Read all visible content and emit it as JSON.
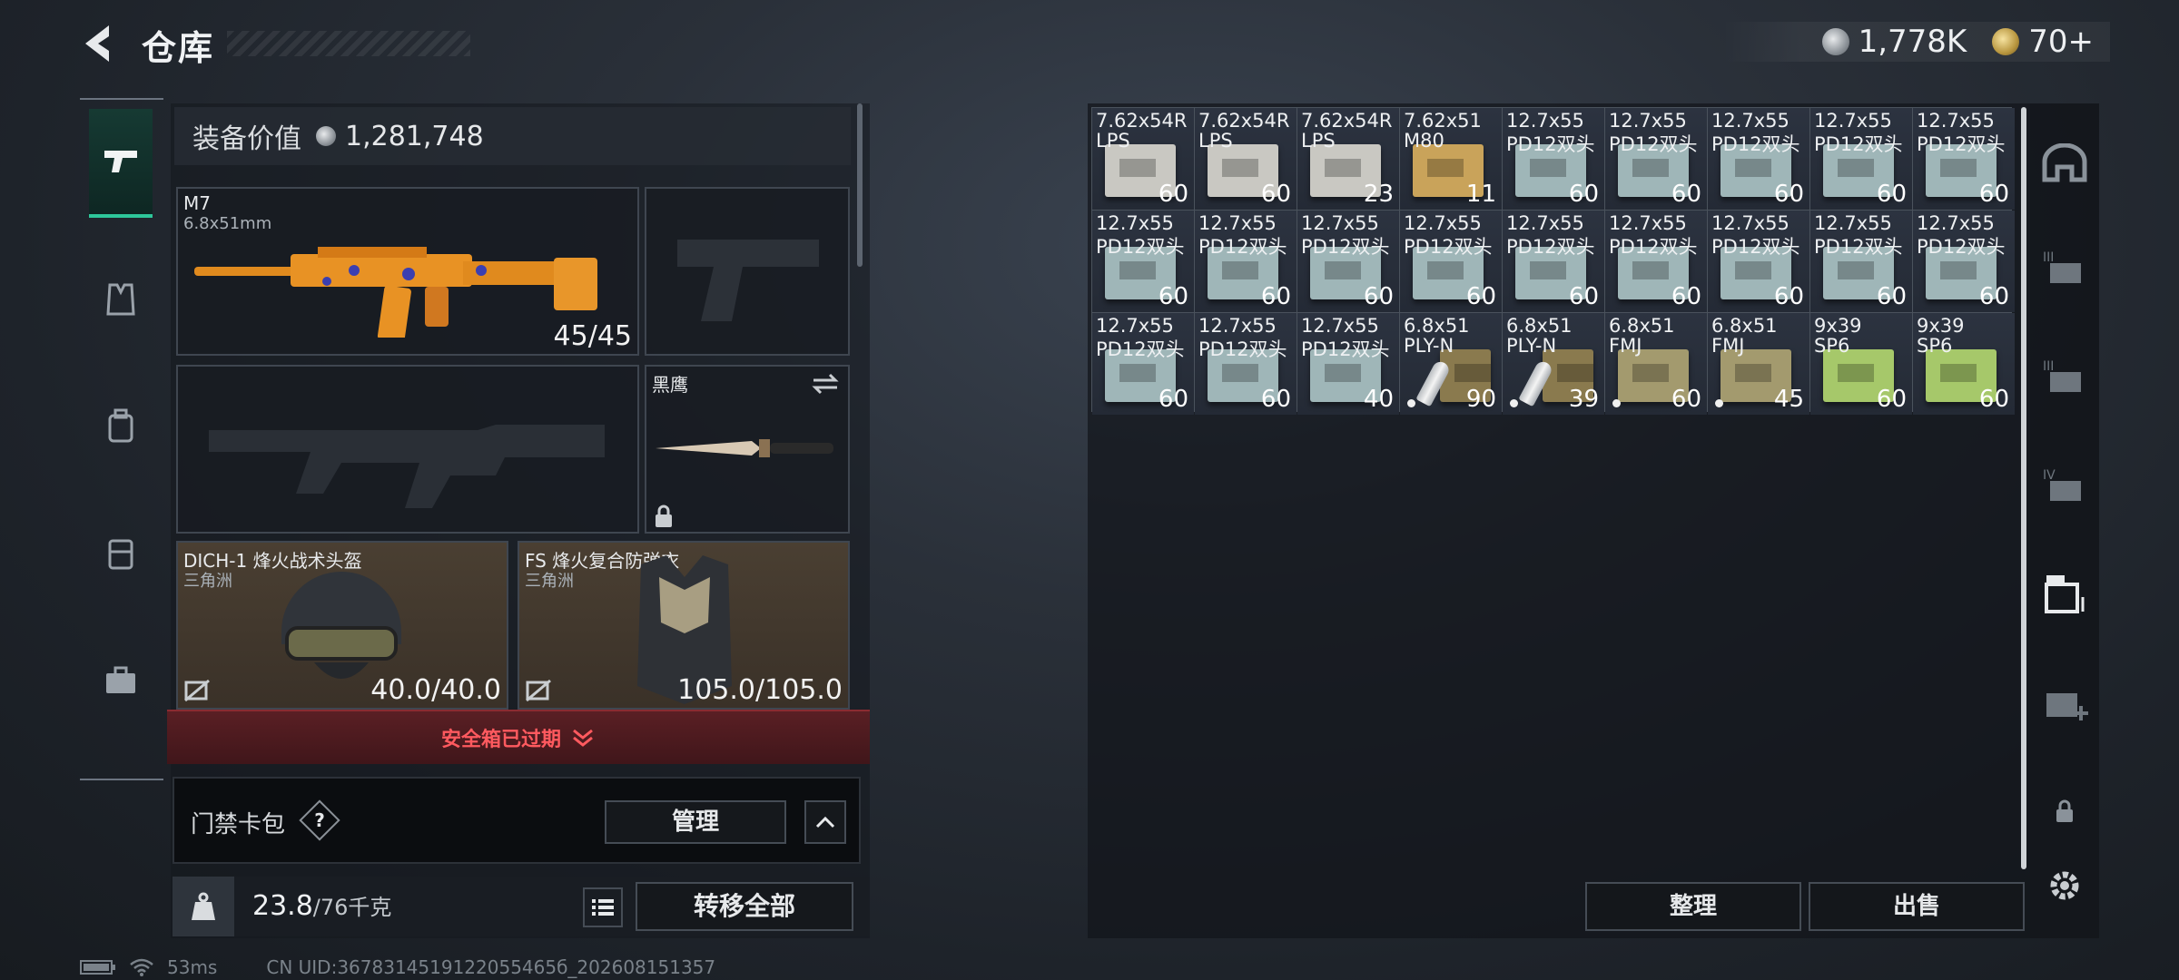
{
  "header": {
    "title": "仓库",
    "currencies": [
      {
        "icon": "silver-coin-icon",
        "value": "1,778K"
      },
      {
        "icon": "gold-coin-icon",
        "value": "70+"
      }
    ]
  },
  "left_tabs": [
    {
      "name": "firearms-tab",
      "icon": "pistol-icon",
      "active": true
    },
    {
      "name": "armor-tab",
      "icon": "vest-icon",
      "active": false
    },
    {
      "name": "backpack-tab",
      "icon": "backpack-icon",
      "active": false
    },
    {
      "name": "chest-rig-tab",
      "icon": "chest-rig-icon",
      "active": false
    },
    {
      "name": "toolbox-tab",
      "icon": "briefcase-icon",
      "active": false
    }
  ],
  "equipment": {
    "value_label": "装备价值",
    "value": "1,281,748",
    "primary_weapon": {
      "name": "M7",
      "caliber": "6.8x51mm",
      "ammo": "45/45"
    },
    "melee": {
      "name": "黑鹰"
    },
    "helmet": {
      "name": "DICH-1 烽火战术头盔",
      "brand": "三角洲",
      "durability": "40.0/40.0"
    },
    "armor": {
      "name": "FS 烽火复合防弹衣",
      "brand": "三角洲",
      "durability": "105.0/105.0"
    },
    "safebox_text": "安全箱已过期",
    "keycard_label": "门禁卡包",
    "help_label": "?",
    "manage_label": "管理",
    "weight_current": "23.8",
    "weight_max": "/76千克",
    "transfer_all_label": "转移全部"
  },
  "status": {
    "ping": "53ms",
    "uid": "CN UID:3678314519122055465б_202608151357"
  },
  "storage": {
    "items": [
      {
        "n1": "7.62x54R",
        "n2": "LPS",
        "count": "60",
        "color": "#c9c8c2",
        "kind": "box"
      },
      {
        "n1": "7.62x54R",
        "n2": "LPS",
        "count": "60",
        "color": "#c9c8c2",
        "kind": "box"
      },
      {
        "n1": "7.62x54R",
        "n2": "LPS",
        "count": "23",
        "color": "#c9c8c2",
        "kind": "box"
      },
      {
        "n1": "7.62x51",
        "n2": "M80",
        "count": "11",
        "color": "#c9a35a",
        "kind": "box"
      },
      {
        "n1": "12.7x55",
        "n2": "PD12双头",
        "count": "60",
        "color": "#9fb6b8",
        "kind": "box"
      },
      {
        "n1": "12.7x55",
        "n2": "PD12双头",
        "count": "60",
        "color": "#9fb6b8",
        "kind": "box"
      },
      {
        "n1": "12.7x55",
        "n2": "PD12双头",
        "count": "60",
        "color": "#9fb6b8",
        "kind": "box"
      },
      {
        "n1": "12.7x55",
        "n2": "PD12双头",
        "count": "60",
        "color": "#9fb6b8",
        "kind": "box"
      },
      {
        "n1": "12.7x55",
        "n2": "PD12双头",
        "count": "60",
        "color": "#9fb6b8",
        "kind": "box"
      },
      {
        "n1": "12.7x55",
        "n2": "PD12双头",
        "count": "60",
        "color": "#9fb6b8",
        "kind": "box"
      },
      {
        "n1": "12.7x55",
        "n2": "PD12双头",
        "count": "60",
        "color": "#9fb6b8",
        "kind": "box"
      },
      {
        "n1": "12.7x55",
        "n2": "PD12双头",
        "count": "60",
        "color": "#9fb6b8",
        "kind": "box"
      },
      {
        "n1": "12.7x55",
        "n2": "PD12双头",
        "count": "60",
        "color": "#9fb6b8",
        "kind": "box"
      },
      {
        "n1": "12.7x55",
        "n2": "PD12双头",
        "count": "60",
        "color": "#9fb6b8",
        "kind": "box"
      },
      {
        "n1": "12.7x55",
        "n2": "PD12双头",
        "count": "60",
        "color": "#9fb6b8",
        "kind": "box"
      },
      {
        "n1": "12.7x55",
        "n2": "PD12双头",
        "count": "60",
        "color": "#9fb6b8",
        "kind": "box"
      },
      {
        "n1": "12.7x55",
        "n2": "PD12双头",
        "count": "60",
        "color": "#9fb6b8",
        "kind": "box"
      },
      {
        "n1": "12.7x55",
        "n2": "PD12双头",
        "count": "60",
        "color": "#9fb6b8",
        "kind": "box"
      },
      {
        "n1": "12.7x55",
        "n2": "PD12双头",
        "count": "60",
        "color": "#9fb6b8",
        "kind": "box"
      },
      {
        "n1": "12.7x55",
        "n2": "PD12双头",
        "count": "60",
        "color": "#9fb6b8",
        "kind": "box"
      },
      {
        "n1": "12.7x55",
        "n2": "PD12双头",
        "count": "40",
        "color": "#9fb6b8",
        "kind": "box"
      },
      {
        "n1": "6.8x51",
        "n2": "PLY-N",
        "count": "90",
        "color": "#8a7a4e",
        "kind": "cart",
        "dot": true
      },
      {
        "n1": "6.8x51",
        "n2": "PLY-N",
        "count": "39",
        "color": "#8a7a4e",
        "kind": "cart",
        "dot": true
      },
      {
        "n1": "6.8x51",
        "n2": "FMJ",
        "count": "60",
        "color": "#a39a6e",
        "kind": "box",
        "dot": true
      },
      {
        "n1": "6.8x51",
        "n2": "FMJ",
        "count": "45",
        "color": "#a39a6e",
        "kind": "box",
        "dot": true
      },
      {
        "n1": "9x39",
        "n2": "SP6",
        "count": "60",
        "color": "#a6c86a",
        "kind": "box"
      },
      {
        "n1": "9x39",
        "n2": "SP6",
        "count": "60",
        "color": "#a6c86a",
        "kind": "box"
      }
    ],
    "sort_label": "整理",
    "sell_label": "出售"
  },
  "right_tabs": [
    {
      "name": "storage-home-tab",
      "icon": "arch-icon"
    },
    {
      "name": "storage-page-3a-tab",
      "icon": "storage-iii-icon"
    },
    {
      "name": "storage-page-3b-tab",
      "icon": "storage-iii-icon"
    },
    {
      "name": "storage-page-4-tab",
      "icon": "storage-iv-icon"
    },
    {
      "name": "storage-page-5-tab",
      "icon": "storage-active-icon"
    },
    {
      "name": "storage-add-tab",
      "icon": "storage-add-icon"
    },
    {
      "name": "lock-tab",
      "icon": "lock-icon"
    },
    {
      "name": "settings-tab",
      "icon": "gear-icon"
    }
  ]
}
